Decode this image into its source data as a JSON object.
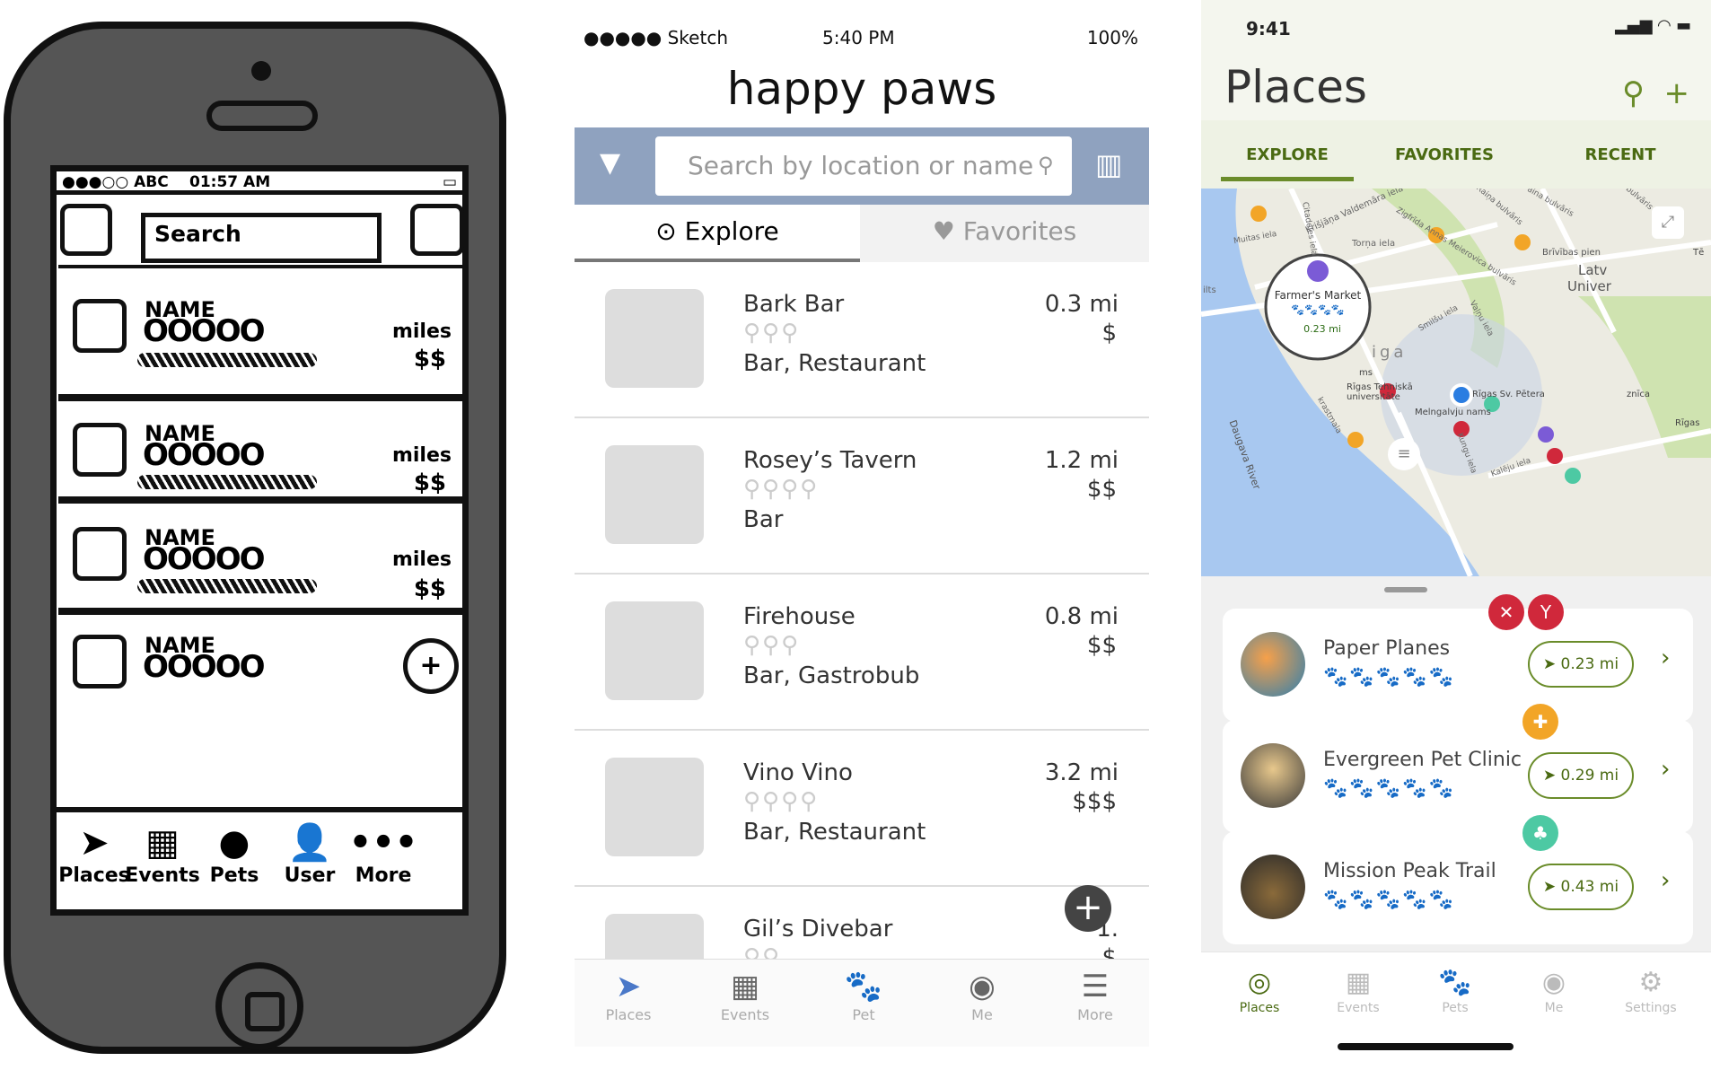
{
  "wireframe": {
    "status": {
      "carrier": "●●●○○ ABC",
      "time": "01:57 AM",
      "battery": "▭"
    },
    "search_label": "Search",
    "rows": [
      {
        "name": "NAME",
        "rating": "OOOOO",
        "miles": "miles",
        "price": "$$"
      },
      {
        "name": "NAME",
        "rating": "OOOOO",
        "miles": "miles",
        "price": "$$"
      },
      {
        "name": "NAME",
        "rating": "OOOOO",
        "miles": "miles",
        "price": "$$"
      },
      {
        "name": "NAME",
        "rating": "OOOOO",
        "miles": "",
        "price": "$$"
      }
    ],
    "plus": "+",
    "tabs": [
      {
        "icon": "➤",
        "label": "Places"
      },
      {
        "icon": "▦",
        "label": "Events"
      },
      {
        "icon": "●",
        "label": "Pets"
      },
      {
        "icon": "👤",
        "label": "User"
      },
      {
        "icon": "•••",
        "label": "More"
      }
    ]
  },
  "mid": {
    "status": {
      "carrier": "●●●●● Sketch",
      "time": "5:40 PM",
      "battery": "100%"
    },
    "logo": "happy paws",
    "search_placeholder": "Search by location or name",
    "tabs": [
      {
        "label": "Explore"
      },
      {
        "label": "Favorites"
      }
    ],
    "places": [
      {
        "name": "Bark Bar",
        "bones": "⚲⚲⚲",
        "category": "Bar, Restaurant",
        "distance": "0.3 mi",
        "price": "$"
      },
      {
        "name": "Rosey’s Tavern",
        "bones": "⚲⚲⚲⚲",
        "category": "Bar",
        "distance": "1.2 mi",
        "price": "$$"
      },
      {
        "name": "Firehouse",
        "bones": "⚲⚲⚲",
        "category": "Bar, Gastrobub",
        "distance": "0.8 mi",
        "price": "$$"
      },
      {
        "name": "Vino Vino",
        "bones": "⚲⚲⚲⚲",
        "category": "Bar, Restaurant",
        "distance": "3.2 mi",
        "price": "$$$"
      },
      {
        "name": "Gil’s Divebar",
        "bones": "⚲⚲",
        "category": "",
        "distance": "1.",
        "price": "$"
      }
    ],
    "nav": [
      {
        "icon": "➤",
        "label": "Places"
      },
      {
        "icon": "▦",
        "label": "Events"
      },
      {
        "icon": "🐾",
        "label": "Pet"
      },
      {
        "icon": "◉",
        "label": "Me"
      },
      {
        "icon": "☰",
        "label": "More"
      }
    ]
  },
  "hifi": {
    "status_time": "9:41",
    "title": "Places",
    "tabs": [
      {
        "label": "EXPLORE"
      },
      {
        "label": "FAVORITES"
      },
      {
        "label": "RECENT"
      }
    ],
    "map_labels": [
      "Farmer's Market",
      "0.23 mi",
      "Daugava River",
      "Torņa iela",
      "Krišjāņa Valdemāra iela",
      "Brīvības pien",
      "Latv",
      "Univer",
      "Rīgas Tehniskā universitāte",
      "Rīgas Sv. Pētera",
      "Melngalvju nams",
      "Rīgas",
      "Kalēju iela",
      "Citadeles iela",
      "Smilšu iela",
      "Vaļņu iela",
      "Kungu iela",
      "Muitas iela",
      "Zigfrīda Annas Meierovica bulvāris",
      "Raiņa bulvāris",
      "ilts",
      "ms",
      "iga",
      "Tē",
      "aina bulvāris",
      "bulvāris",
      "krastmala",
      "znīca"
    ],
    "cards": [
      {
        "name": "Paper Planes",
        "paws_on": "🐾🐾🐾🐾",
        "paws_off": "🐾",
        "distance": "0.23 mi"
      },
      {
        "name": "Evergreen Pet Clinic",
        "paws_on": "🐾🐾🐾",
        "paws_off": "🐾🐾",
        "distance": "0.29 mi"
      },
      {
        "name": "Mission Peak Trail",
        "paws_on": "🐾🐾🐾🐾",
        "paws_off": "🐾",
        "distance": "0.43 mi"
      }
    ],
    "nav": [
      {
        "icon": "◎",
        "label": "Places"
      },
      {
        "icon": "▦",
        "label": "Events"
      },
      {
        "icon": "🐾",
        "label": "Pets"
      },
      {
        "icon": "◉",
        "label": "Me"
      },
      {
        "icon": "⚙",
        "label": "Settings"
      }
    ],
    "colors": {
      "accent": "#6a8c2a",
      "red_badge": "#d0283b",
      "orange_badge": "#f2a527",
      "teal_badge": "#4dc9a3"
    }
  }
}
